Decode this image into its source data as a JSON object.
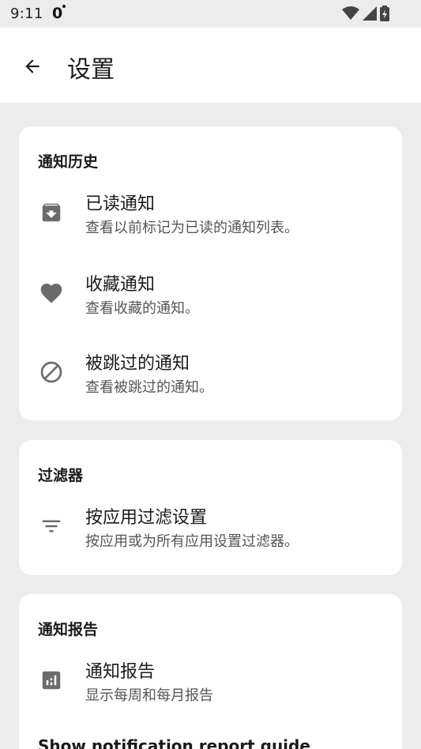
{
  "status_bar": {
    "time": "9:11",
    "indicator": "0"
  },
  "app_bar": {
    "title": "设置"
  },
  "sections": [
    {
      "title": "通知历史",
      "items": [
        {
          "icon": "archive-icon",
          "title": "已读通知",
          "subtitle": "查看以前标记为已读的通知列表。"
        },
        {
          "icon": "heart-icon",
          "title": "收藏通知",
          "subtitle": "查看收藏的通知。"
        },
        {
          "icon": "block-icon",
          "title": "被跳过的通知",
          "subtitle": "查看被跳过的通知。"
        }
      ]
    },
    {
      "title": "过滤器",
      "items": [
        {
          "icon": "filter-icon",
          "title": "按应用过滤设置",
          "subtitle": "按应用或为所有应用设置过滤器。"
        }
      ]
    },
    {
      "title": "通知报告",
      "items": [
        {
          "icon": "bar-chart-icon",
          "title": "通知报告",
          "subtitle": "显示每周和每月报告"
        }
      ],
      "link": "Show notification report guide"
    }
  ],
  "colors": {
    "background": "#ececec",
    "card": "#ffffff",
    "icon": "#6b6b6b"
  }
}
